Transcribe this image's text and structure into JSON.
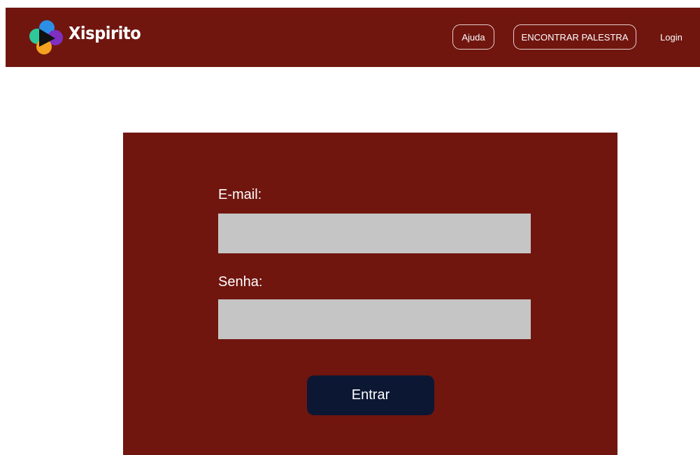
{
  "header": {
    "brand": "Xispirito",
    "nav": {
      "help": "Ajuda",
      "find_talk": "ENCONTRAR PALESTRA",
      "login": "Login"
    }
  },
  "login_form": {
    "email_label": "E-mail:",
    "email_value": "",
    "password_label": "Senha:",
    "password_value": "",
    "submit_label": "Entrar"
  },
  "colors": {
    "primary": "#70160f",
    "button": "#0c1734",
    "field": "#c5c5c5",
    "logo_teal": "#2fc89a",
    "logo_blue": "#2c8fe5",
    "logo_purple": "#7f2fc1",
    "logo_orange": "#f4a21f",
    "logo_play": "#111111"
  },
  "icons": {
    "logo": "xispirito-logo-icon"
  }
}
